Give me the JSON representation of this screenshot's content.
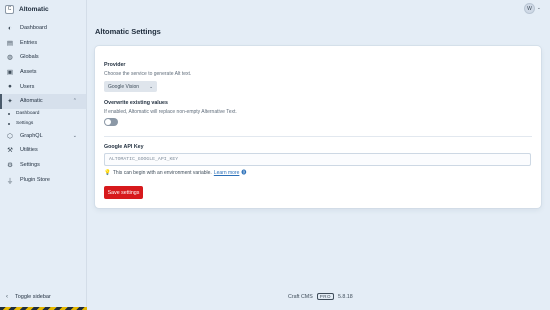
{
  "site": {
    "icon_letter": "C",
    "name": "Altomatic"
  },
  "sidebar": {
    "items": [
      {
        "label": "Dashboard",
        "icon": "gauge-icon"
      },
      {
        "label": "Entries",
        "icon": "entries-icon"
      },
      {
        "label": "Globals",
        "icon": "globe-icon"
      },
      {
        "label": "Assets",
        "icon": "image-icon"
      },
      {
        "label": "Users",
        "icon": "users-icon"
      },
      {
        "label": "Altomatic",
        "icon": "sparkle-icon"
      },
      {
        "label": "GraphQL",
        "icon": "graphql-icon"
      },
      {
        "label": "Utilities",
        "icon": "wrench-icon"
      },
      {
        "label": "Settings",
        "icon": "gear-icon"
      },
      {
        "label": "Plugin Store",
        "icon": "plug-icon"
      }
    ],
    "subitems": [
      {
        "label": "Dashboard"
      },
      {
        "label": "Settings"
      }
    ],
    "toggle_label": "Toggle sidebar"
  },
  "header": {
    "avatar_letter": "W"
  },
  "page": {
    "title": "Altomatic Settings"
  },
  "form": {
    "provider": {
      "label": "Provider",
      "instructions": "Choose the service to generate Alt text.",
      "selected": "Google Vision"
    },
    "overwrite": {
      "label": "Overwrite existing values",
      "instructions": "If enabled, Altomatic will replace non-empty Alternative Text.",
      "enabled": false
    },
    "api_key": {
      "label": "Google API Key",
      "value": "ALTOMATIC_GOOGLE_API_KEY",
      "tip_text": "This can begin with an environment variable.",
      "tip_link": "Learn more"
    },
    "save_label": "Save settings"
  },
  "footer": {
    "product": "Craft CMS",
    "edition": "PRO",
    "version": "5.8.18"
  },
  "colors": {
    "accent": "#d7191c",
    "background": "#e4edf6"
  }
}
